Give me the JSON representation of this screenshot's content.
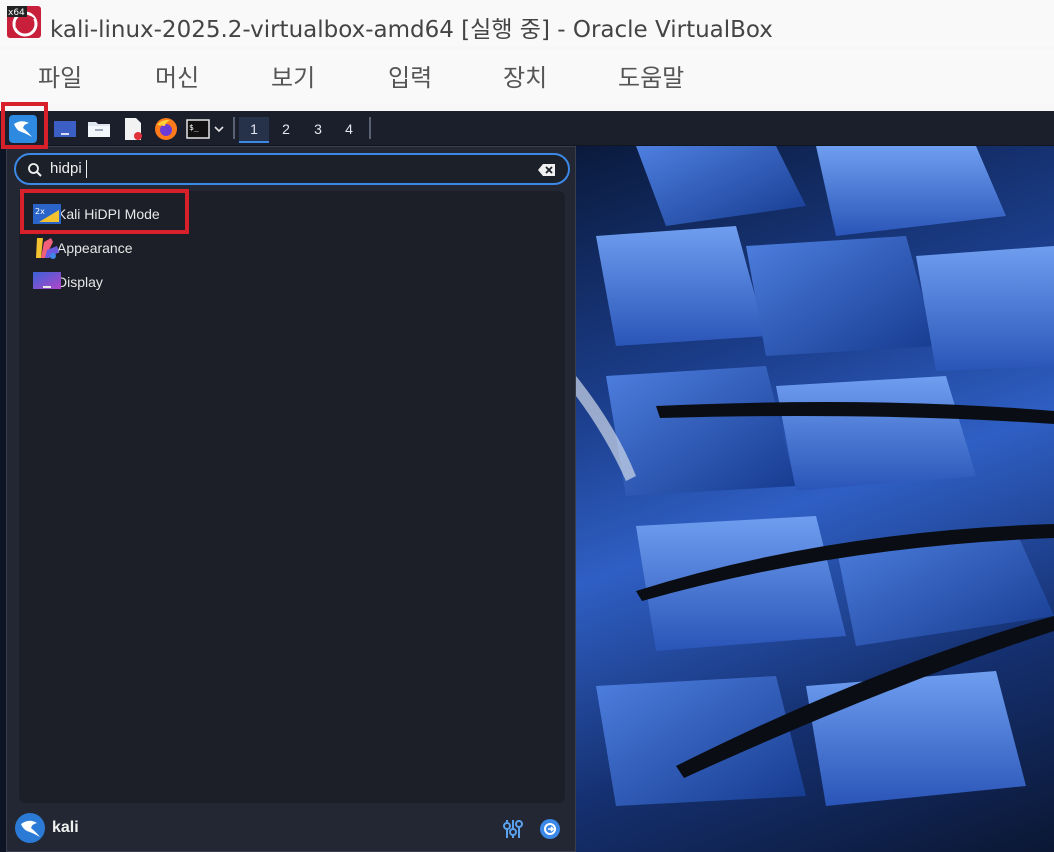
{
  "window": {
    "title": "kali-linux-2025.2-virtualbox-amd64 [실행 중] - Oracle VirtualBox",
    "logo_badge": "x64"
  },
  "menubar": [
    "파일",
    "머신",
    "보기",
    "입력",
    "장치",
    "도움말"
  ],
  "panel": {
    "icons": [
      "kali-menu-icon",
      "desktop-icon",
      "file-manager-icon",
      "text-editor-icon",
      "firefox-icon",
      "terminal-icon",
      "chevron-down-icon"
    ],
    "workspaces": [
      "1",
      "2",
      "3",
      "4"
    ],
    "active_workspace": "1"
  },
  "menu": {
    "search_value": "hidpi",
    "results": [
      {
        "label": "Kali HiDPI Mode",
        "icon": "hidpi-icon",
        "badge": "2x"
      },
      {
        "label": "Appearance",
        "icon": "appearance-icon"
      },
      {
        "label": "Display",
        "icon": "display-icon"
      }
    ],
    "user": "kali"
  },
  "colors": {
    "accent": "#3b88e6",
    "highlight": "#d8202a",
    "panel": "#1a1f2b"
  }
}
